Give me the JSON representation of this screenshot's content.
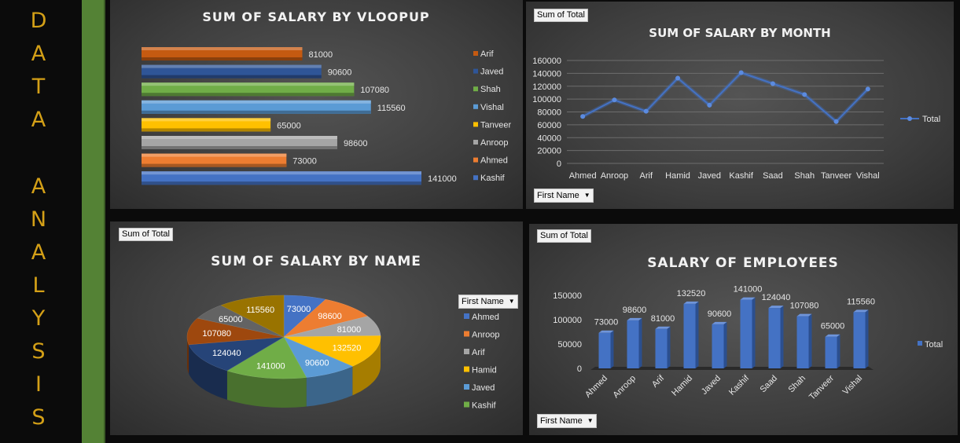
{
  "sidebar": {
    "word1": "DATA",
    "word2": "ANALYSIS",
    "color": "#d4a017",
    "green": "#548235"
  },
  "charts": {
    "vloopup": {
      "title": "SUM OF SALARY BY VLOOPUP"
    },
    "month": {
      "title": "SUM OF SALARY BY MONTH",
      "pill": "Sum of Total",
      "filter": "First Name"
    },
    "name": {
      "title": "SUM OF SALARY BY NAME",
      "pill": "Sum of Total",
      "filter": "First Name"
    },
    "employees": {
      "title": "SALARY OF EMPLOYEES",
      "pill": "Sum of Total",
      "filter": "First Name"
    }
  },
  "chart_data": [
    {
      "type": "bar",
      "orientation": "horizontal",
      "title": "SUM OF SALARY BY VLOOPUP",
      "categories": [
        "Arif",
        "Javed",
        "Shah",
        "Vishal",
        "Tanveer",
        "Anroop",
        "Ahmed",
        "Kashif"
      ],
      "values": [
        81000,
        90600,
        107080,
        115560,
        65000,
        98600,
        73000,
        141000
      ],
      "colors": [
        "#c55a11",
        "#2f5597",
        "#70ad47",
        "#5b9bd5",
        "#ffc000",
        "#a5a5a5",
        "#ed7d31",
        "#4472c4"
      ],
      "data_labels": true,
      "legend_position": "right"
    },
    {
      "type": "line",
      "title": "SUM OF SALARY BY MONTH",
      "categories": [
        "Ahmed",
        "Anroop",
        "Arif",
        "Hamid",
        "Javed",
        "Kashif",
        "Saad",
        "Shah",
        "Tanveer",
        "Vishal"
      ],
      "series": [
        {
          "name": "Total",
          "values": [
            73000,
            98600,
            81000,
            132520,
            90600,
            141000,
            124040,
            107080,
            65000,
            115560
          ]
        }
      ],
      "yticks": [
        0,
        20000,
        40000,
        60000,
        80000,
        100000,
        120000,
        140000,
        160000
      ],
      "ylim": [
        0,
        160000
      ],
      "color": "#4472c4",
      "grid": true,
      "legend_position": "right"
    },
    {
      "type": "pie",
      "title": "SUM OF SALARY BY NAME",
      "categories": [
        "Ahmed",
        "Anroop",
        "Arif",
        "Hamid",
        "Javed",
        "Kashif",
        "Saad",
        "Shah",
        "Tanveer",
        "Vishal"
      ],
      "values": [
        73000,
        98600,
        81000,
        132520,
        90600,
        141000,
        124040,
        107080,
        65000,
        115560
      ],
      "colors": [
        "#4472c4",
        "#ed7d31",
        "#a5a5a5",
        "#ffc000",
        "#5b9bd5",
        "#70ad47",
        "#264478",
        "#9e480e",
        "#636363",
        "#997300"
      ],
      "legend_items": [
        "Ahmed",
        "Anroop",
        "Arif",
        "Hamid",
        "Javed",
        "Kashif"
      ],
      "data_labels": true,
      "legend_position": "right"
    },
    {
      "type": "bar",
      "title": "SALARY OF EMPLOYEES",
      "categories": [
        "Ahmed",
        "Anroop",
        "Arif",
        "Hamid",
        "Javed",
        "Kashif",
        "Saad",
        "Shah",
        "Tanveer",
        "Vishal"
      ],
      "series": [
        {
          "name": "Total",
          "values": [
            73000,
            98600,
            81000,
            132520,
            90600,
            141000,
            124040,
            107080,
            65000,
            115560
          ]
        }
      ],
      "yticks": [
        0,
        50000,
        100000,
        150000
      ],
      "ylim": [
        0,
        150000
      ],
      "color": "#4472c4",
      "data_labels": true,
      "legend_position": "right"
    }
  ]
}
